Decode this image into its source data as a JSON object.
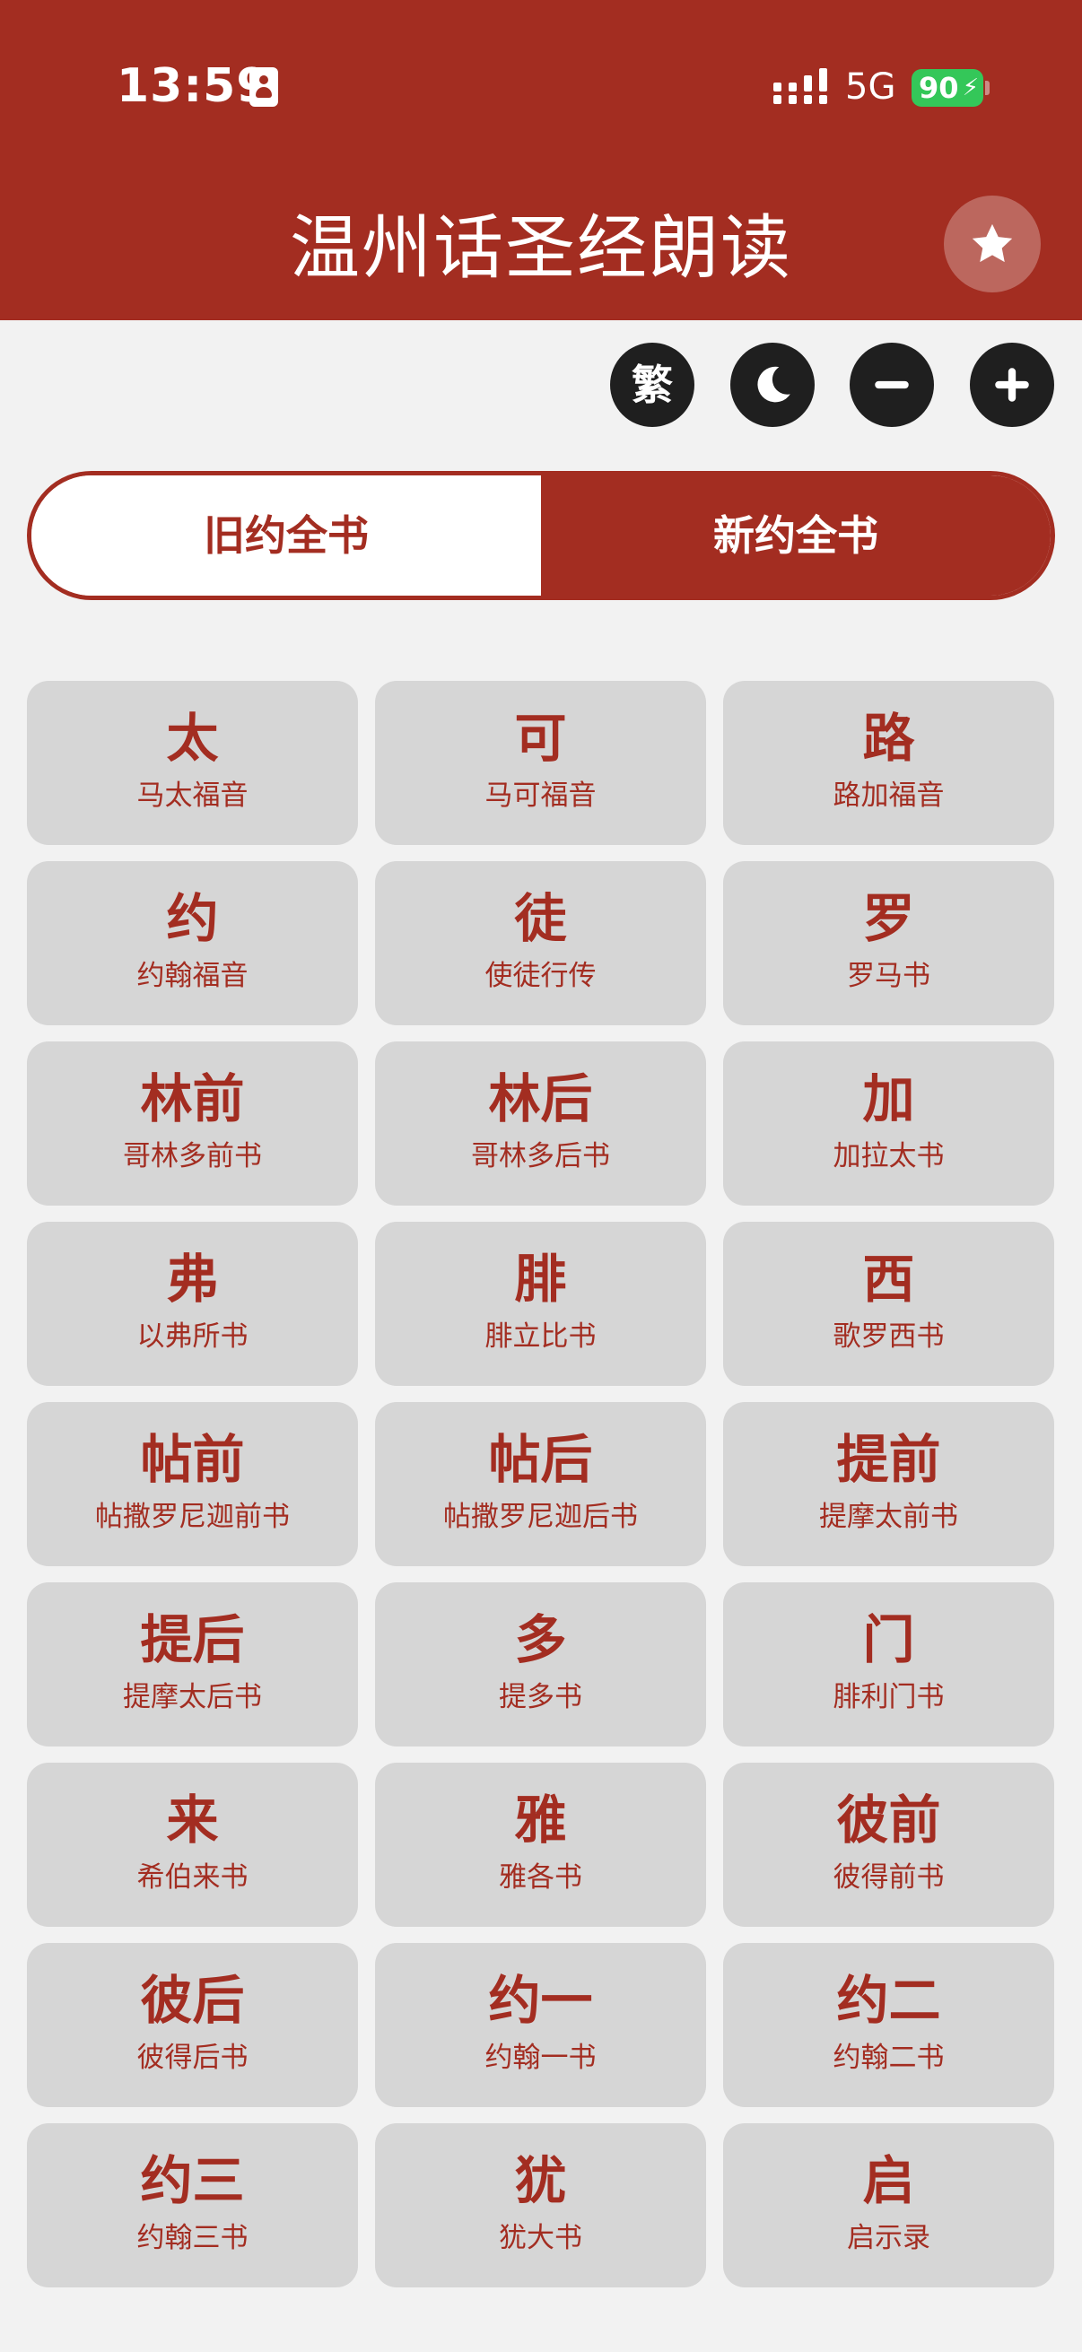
{
  "status_bar": {
    "time": "13:59",
    "network": "5G",
    "battery": "90"
  },
  "header": {
    "title": "温州话圣经朗读"
  },
  "toolbar": {
    "traditional_label": "繁"
  },
  "tabs": [
    {
      "label": "旧约全书",
      "selected": false
    },
    {
      "label": "新约全书",
      "selected": true
    }
  ],
  "books": [
    {
      "abbr": "太",
      "name": "马太福音"
    },
    {
      "abbr": "可",
      "name": "马可福音"
    },
    {
      "abbr": "路",
      "name": "路加福音"
    },
    {
      "abbr": "约",
      "name": "约翰福音"
    },
    {
      "abbr": "徒",
      "name": "使徒行传"
    },
    {
      "abbr": "罗",
      "name": "罗马书"
    },
    {
      "abbr": "林前",
      "name": "哥林多前书"
    },
    {
      "abbr": "林后",
      "name": "哥林多后书"
    },
    {
      "abbr": "加",
      "name": "加拉太书"
    },
    {
      "abbr": "弗",
      "name": "以弗所书"
    },
    {
      "abbr": "腓",
      "name": "腓立比书"
    },
    {
      "abbr": "西",
      "name": "歌罗西书"
    },
    {
      "abbr": "帖前",
      "name": "帖撒罗尼迦前书"
    },
    {
      "abbr": "帖后",
      "name": "帖撒罗尼迦后书"
    },
    {
      "abbr": "提前",
      "name": "提摩太前书"
    },
    {
      "abbr": "提后",
      "name": "提摩太后书"
    },
    {
      "abbr": "多",
      "name": "提多书"
    },
    {
      "abbr": "门",
      "name": "腓利门书"
    },
    {
      "abbr": "来",
      "name": "希伯来书"
    },
    {
      "abbr": "雅",
      "name": "雅各书"
    },
    {
      "abbr": "彼前",
      "name": "彼得前书"
    },
    {
      "abbr": "彼后",
      "name": "彼得后书"
    },
    {
      "abbr": "约一",
      "name": "约翰一书"
    },
    {
      "abbr": "约二",
      "name": "约翰二书"
    },
    {
      "abbr": "约三",
      "name": "约翰三书"
    },
    {
      "abbr": "犹",
      "name": "犹大书"
    },
    {
      "abbr": "启",
      "name": "启示录"
    }
  ],
  "icons": {
    "favorite": "star-icon",
    "dark_mode": "moon-icon",
    "font_smaller": "minus-icon",
    "font_larger": "plus-icon"
  },
  "colors": {
    "brand": "#a32d21",
    "card": "#d6d6d6",
    "background": "#f2f2f2",
    "battery": "#34c759"
  }
}
